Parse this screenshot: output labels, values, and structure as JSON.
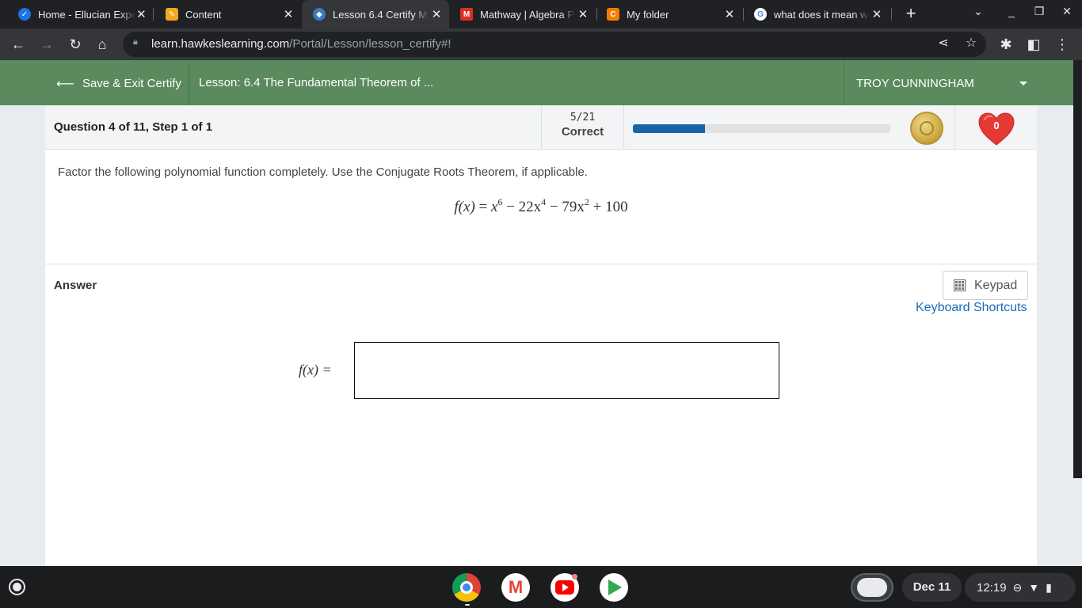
{
  "browser": {
    "tabs": [
      {
        "title": "Home - Ellucian Experience",
        "favicon_color": "#1a73e8",
        "favicon_glyph": "✓",
        "active": false
      },
      {
        "title": "Content",
        "favicon_color": "#f4a81d",
        "favicon_glyph": "✎",
        "active": false
      },
      {
        "title": "Lesson 6.4 Certify M",
        "favicon_color": "#3a7bbf",
        "favicon_glyph": "◆",
        "active": true
      },
      {
        "title": "Mathway | Algebra P",
        "favicon_color": "#d93025",
        "favicon_glyph": "M",
        "active": false
      },
      {
        "title": "My folder",
        "favicon_color": "#f57c00",
        "favicon_glyph": "C",
        "active": false
      },
      {
        "title": "what does it mean w",
        "favicon_color": "#ffffff",
        "favicon_glyph": "G",
        "active": false
      }
    ],
    "url_host": "learn.hawkeslearning.com",
    "url_path": "/Portal/Lesson/lesson_certify#!"
  },
  "nav": {
    "exit_label": "Save & Exit Certify",
    "lesson_title": "Lesson: 6.4 The Fundamental Theorem of ...",
    "user_name": "TROY CUNNINGHAM"
  },
  "question": {
    "label": "Question 4 of 11, Step 1 of 1",
    "score_fraction": "5/21",
    "score_word": "Correct",
    "progress_fraction": 0.28,
    "streak_count": "0",
    "prompt": "Factor the following polynomial function completely. Use the Conjugate Roots Theorem, if applicable.",
    "equation": {
      "lhs": "f(x)",
      "terms": [
        "x",
        "6",
        "− 22x",
        "4",
        "− 79x",
        "2",
        "+ 100"
      ]
    }
  },
  "answer": {
    "label": "Answer",
    "keypad_label": "Keypad",
    "shortcuts_label": "Keyboard Shortcuts",
    "lhs": "f(x) =",
    "value": ""
  },
  "shelf": {
    "date": "Dec 11",
    "time": "12:19"
  },
  "colors": {
    "nav_green": "#5a8a5e",
    "progress_blue": "#1565a8",
    "link_blue": "#1a6bb3",
    "heart_red": "#e53935"
  }
}
